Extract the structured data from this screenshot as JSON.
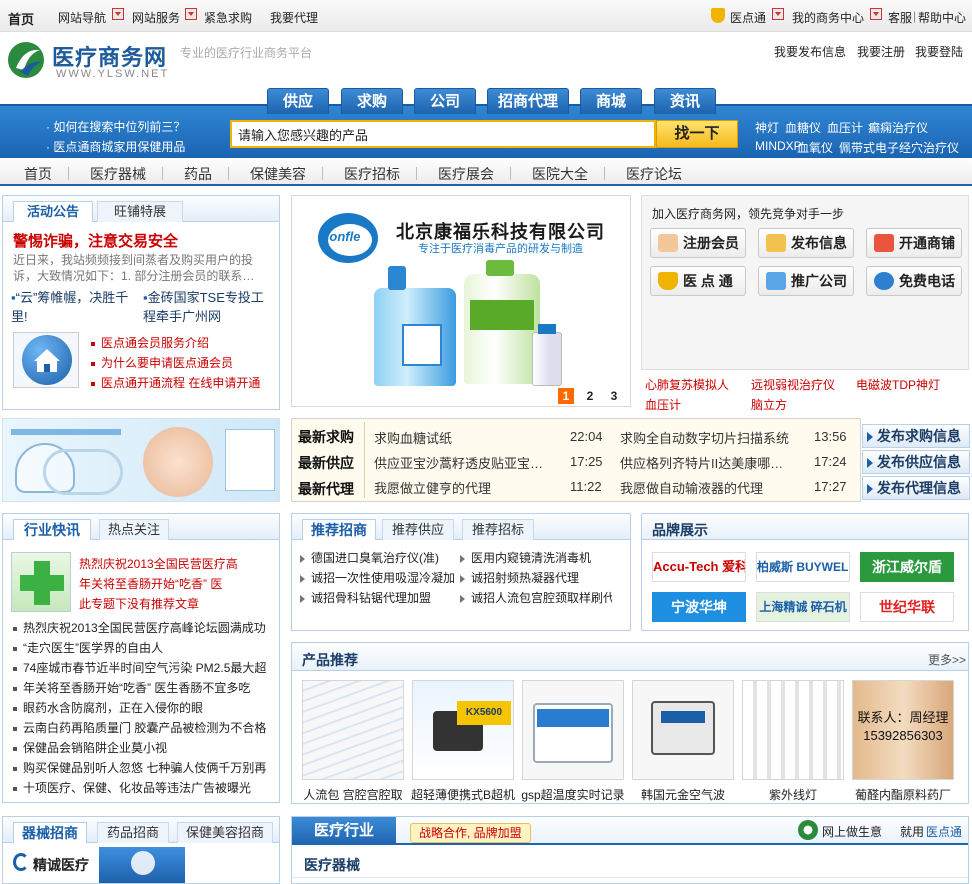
{
  "topbar": {
    "home": "首页",
    "site_nav": "网站导航",
    "site_service": "网站服务",
    "urgent_buy": "紧急求购",
    "agent": "我要代理",
    "yidiantong": "医点通",
    "my_business": "我的商务中心",
    "service": "客服",
    "help": "帮助中心"
  },
  "header": {
    "logo_cn": "医疗商务网",
    "logo_url": "WWW.YLSW.NET",
    "slogan": "专业的医疗行业商务平台",
    "links": [
      "我要发布信息",
      "我要注册",
      "我要登陆"
    ]
  },
  "search_tabs": [
    "供应",
    "求购",
    "公司",
    "招商代理",
    "商城",
    "资讯"
  ],
  "search": {
    "tips": [
      "· 如何在搜索中位列前三？",
      "· 医点通商城家用保健用品"
    ],
    "placeholder": "请输入您感兴趣的产品",
    "button": "找一下",
    "hot_keywords_row1": [
      "神灯",
      "血糖仪",
      "血压计",
      "癫痫治疗仪"
    ],
    "hot_keywords_row2": [
      "MINDXP",
      "血氧仪",
      "佩带式电子经穴治疗仪"
    ]
  },
  "main_nav": [
    "首页",
    "医疗器械",
    "药品",
    "保健美容",
    "医疗招标",
    "医疗展会",
    "医院大全",
    "医疗论坛"
  ],
  "notice": {
    "tabs": [
      "活动公告",
      "旺铺特展"
    ],
    "headline": "警惕诈骗，注意交易安全",
    "summary": "近日来，我站频频接到间蒸者及购买用户的投诉，大致情况如下：1. 部分注册会员的联系…",
    "link1": "“云”筹帷幄，决胜千里!",
    "link2": "金砖国家TSE专投工程牵手广州网",
    "links": [
      "医点通会员服务介绍",
      "为什么要申请医点通会员",
      "医点通开通流程 在线申请开通"
    ]
  },
  "banner": {
    "company": "北京康福乐科技有限公司",
    "tagline": "专注于医疗消毒产品的研发与制造",
    "brand": "Confle",
    "pages": [
      "1",
      "2",
      "3"
    ],
    "active_page": 1
  },
  "join": {
    "title": "加入医疗商务网，领先竞争对手一步",
    "buttons": [
      "注册会员",
      "发布信息",
      "开通商铺",
      "医 点 通",
      "推广公司",
      "免费电话"
    ],
    "ads": [
      "心肺复苏模拟人",
      "远视弱视治疗仪",
      "电磁波TDP神灯",
      "血压计",
      "脑立方"
    ]
  },
  "board": {
    "rows": [
      {
        "label": "最新求购",
        "items": [
          {
            "text": "求购血糖试纸",
            "time": "22:04"
          },
          {
            "text": "求购全自动数字切片扫描系统",
            "time": "13:56"
          }
        ],
        "button": "发布求购信息"
      },
      {
        "label": "最新供应",
        "items": [
          {
            "text": "供应亚宝沙蒿籽透皮贴亚宝…",
            "time": "17:25"
          },
          {
            "text": "供应格列齐特片II达美康哪…",
            "time": "17:24"
          }
        ],
        "button": "发布供应信息"
      },
      {
        "label": "最新代理",
        "items": [
          {
            "text": "我愿做立健亨的代理",
            "time": "11:22"
          },
          {
            "text": "我愿做自动输液器的代理",
            "time": "17:27"
          }
        ],
        "button": "发布代理信息"
      }
    ]
  },
  "news": {
    "tabs": [
      "行业快讯",
      "热点关注"
    ],
    "feature_lines": [
      "热烈庆祝2013全国民营医疗高",
      "年关将至香肠开始“吃香” 医",
      "此专题下没有推荐文章"
    ],
    "items": [
      "热烈庆祝2013全国民营医疗高峰论坛圆满成功",
      "“走穴医生”医学界的自由人",
      "74座城市春节近半时间空气污染 PM2.5最大超",
      "年关将至香肠开始“吃香” 医生香肠不宜多吃",
      "眼药水含防腐剂，正在入侵你的眼",
      "云南白药再陷质量门 胶囊产品被检测为不合格",
      "保健品会销陷阱企业莫小视",
      "购买保健品别听人忽悠 七种骗人伎俩千万别再",
      "十项医疗、保健、化妆品等违法广告被曝光"
    ]
  },
  "zhaoshang": {
    "tabs": [
      "推荐招商",
      "推荐供应",
      "推荐招标"
    ],
    "col1": [
      "德国进口臭氧治疗仪(准)",
      "诚招一次性使用吸湿冷凝加",
      "诚招骨科钻锯代理加盟"
    ],
    "col2": [
      "医用内窥镜清洗消毒机",
      "诚招射频热凝器代理",
      "诚招人流包宫腔颈取样刷代"
    ]
  },
  "brands": {
    "title": "品牌展示",
    "items": [
      "Accu-Tech 爱科凯能",
      "柏威斯 BUYWELLS",
      "浙江威尔盾",
      "宁波华坤",
      "上海精诚 碎石机",
      "世纪华联"
    ]
  },
  "products": {
    "title": "产品推荐",
    "more": "更多>>",
    "items": [
      "人流包 宫腔宫腔取",
      "超轻薄便携式B超机",
      "gsp超温度实时记录",
      "韩国元金空气波",
      "紫外线灯",
      "葡醛内酯原料药厂"
    ],
    "contact_label": "联系人：周经理",
    "contact_phone": "15392856303"
  },
  "bottom": {
    "tabs": [
      "器械招商",
      "药品招商",
      "保健美容招商"
    ],
    "partner": "精诚医疗",
    "section_tab": "医疗行业",
    "promo": "战略合作, 品牌加盟",
    "slogan_a": "网上做生意",
    "slogan_b": "就用",
    "slogan_c": "医点通",
    "section_title": "医疗器械"
  },
  "colors": {
    "brand_blue": "#1b5fa8",
    "accent_red": "#cc0000",
    "search_yellow": "#f6b91c"
  }
}
